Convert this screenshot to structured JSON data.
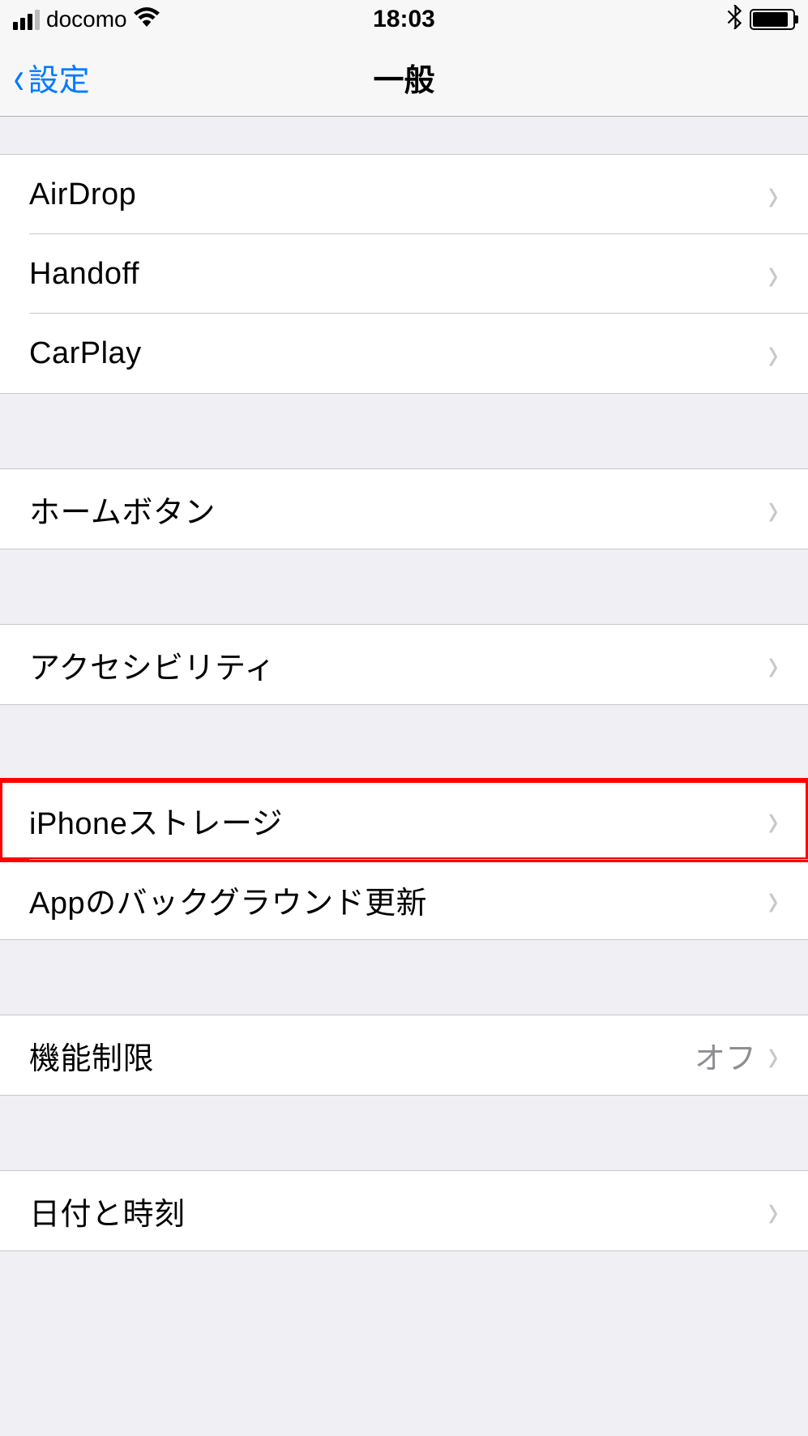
{
  "status_bar": {
    "carrier": "docomo",
    "time": "18:03"
  },
  "nav": {
    "back_label": "設定",
    "title": "一般"
  },
  "groups": [
    {
      "items": [
        {
          "label": "AirDrop"
        },
        {
          "label": "Handoff"
        },
        {
          "label": "CarPlay"
        }
      ]
    },
    {
      "items": [
        {
          "label": "ホームボタン"
        }
      ]
    },
    {
      "items": [
        {
          "label": "アクセシビリティ"
        }
      ]
    },
    {
      "items": [
        {
          "label": "iPhoneストレージ",
          "highlighted": true
        },
        {
          "label": "Appのバックグラウンド更新"
        }
      ]
    },
    {
      "items": [
        {
          "label": "機能制限",
          "value": "オフ"
        }
      ]
    },
    {
      "items": [
        {
          "label": "日付と時刻"
        }
      ]
    }
  ]
}
